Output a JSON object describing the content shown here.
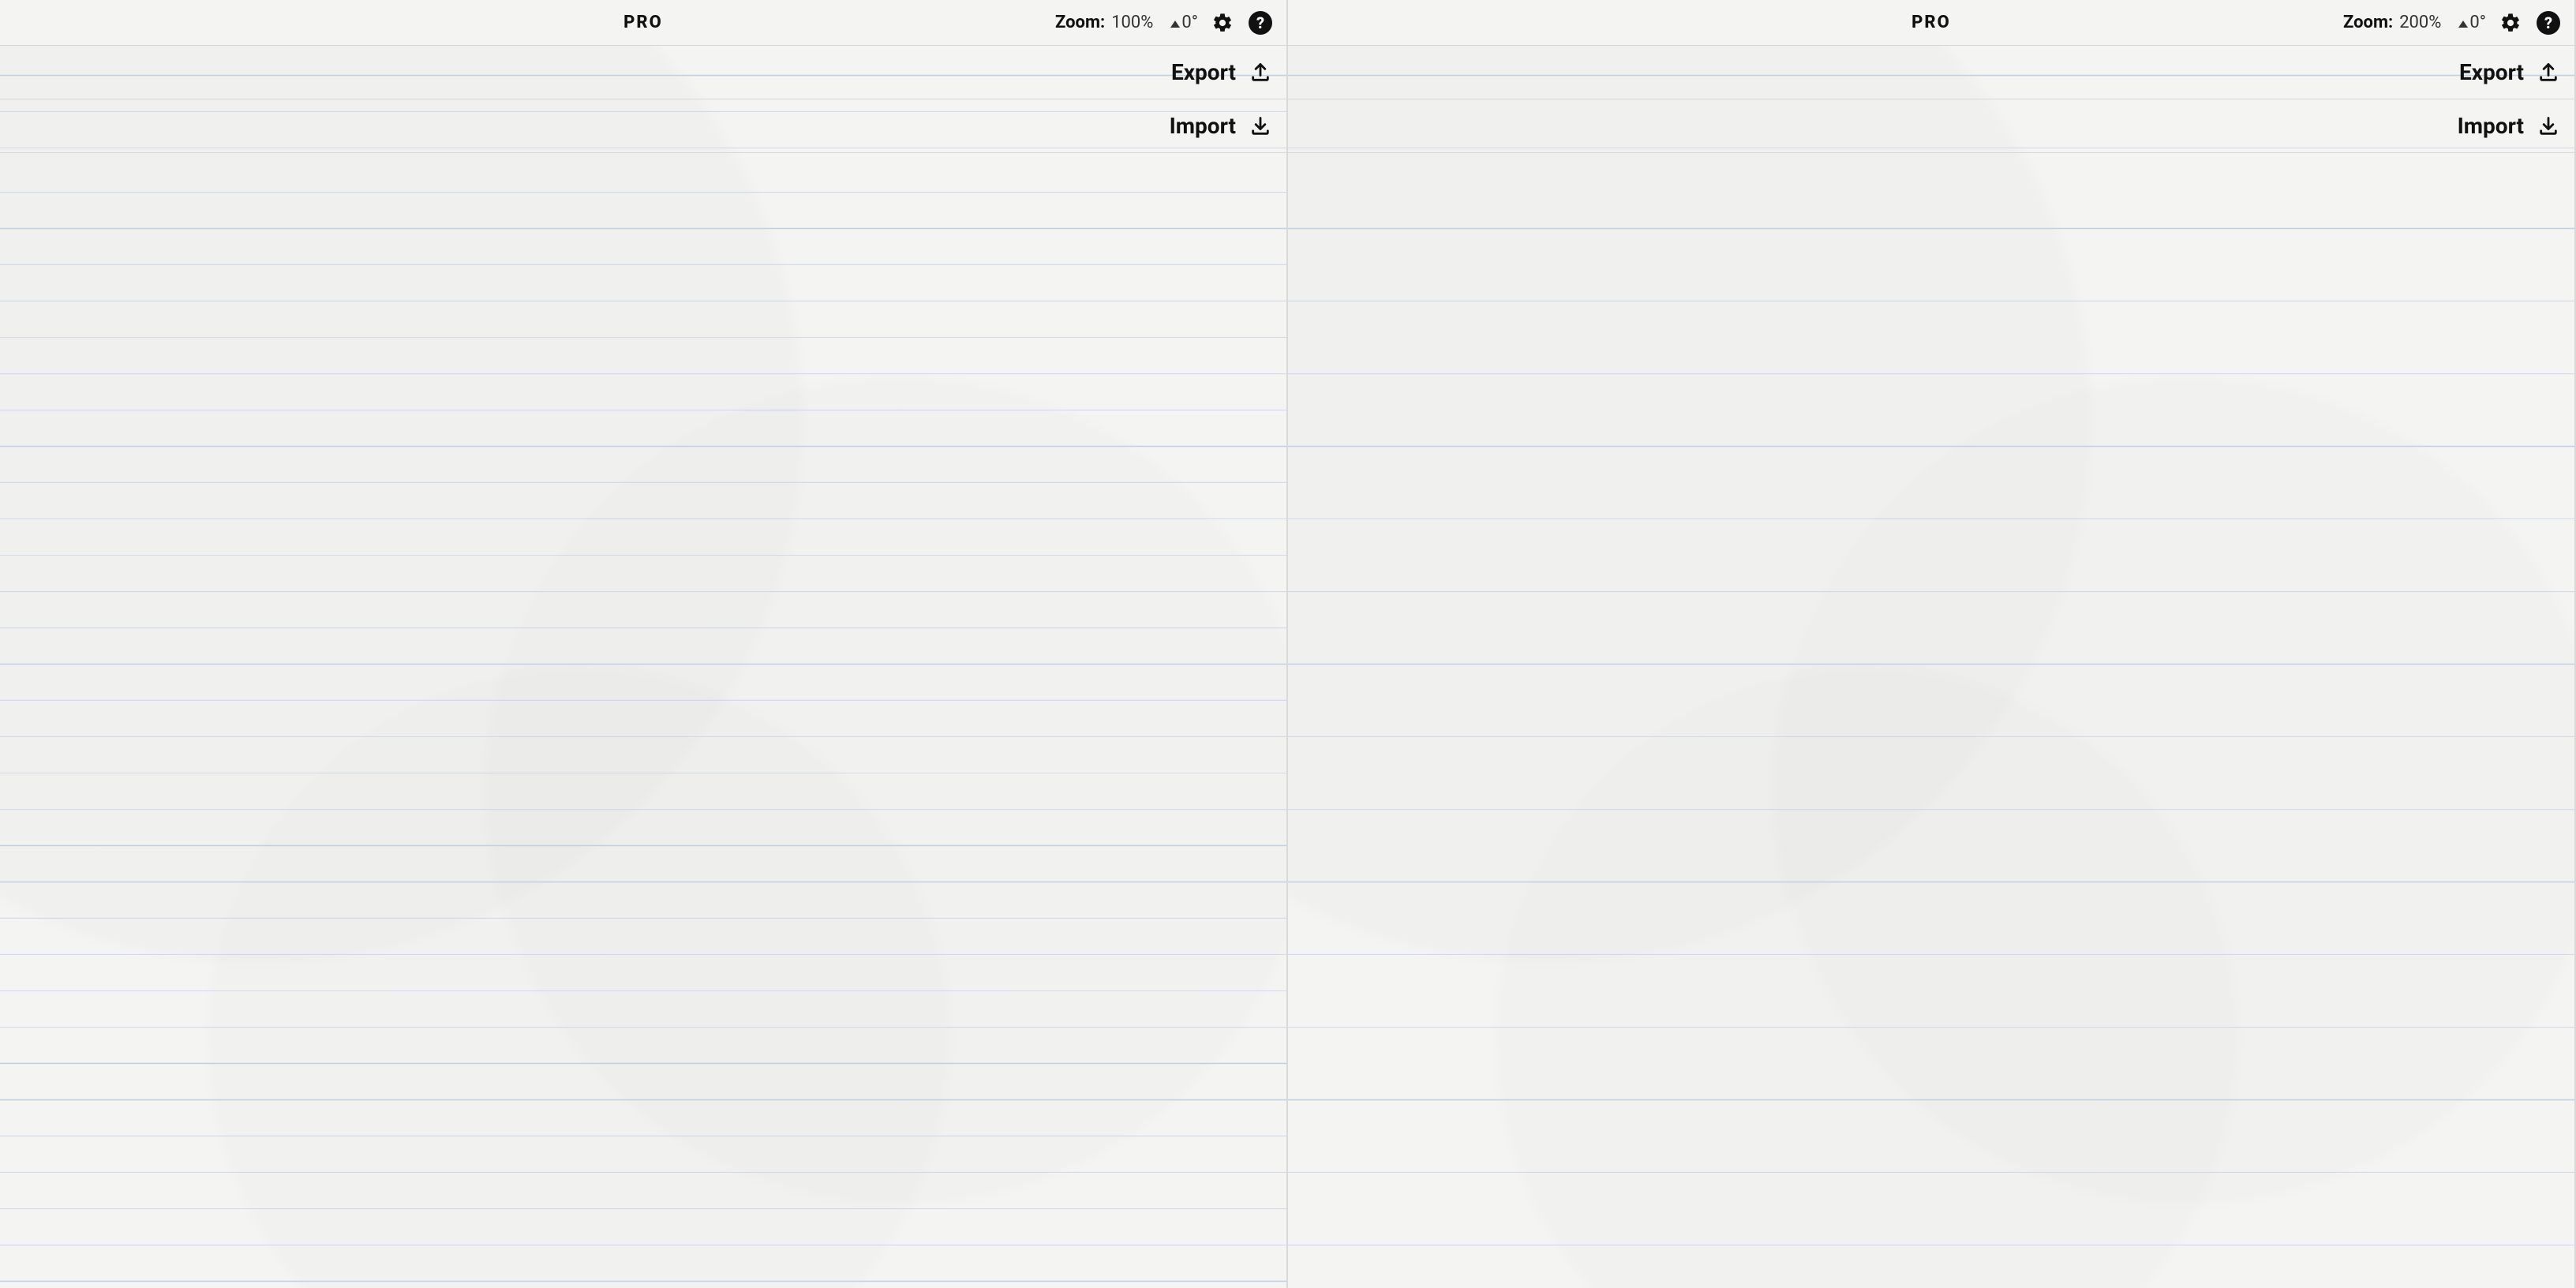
{
  "panes": [
    {
      "badge": "PRO",
      "zoom_label": "Zoom:",
      "zoom_value": "100%",
      "rotation": "0°",
      "export_label": "Export",
      "import_label": "Import"
    },
    {
      "badge": "PRO",
      "zoom_label": "Zoom:",
      "zoom_value": "200%",
      "rotation": "0°",
      "export_label": "Export",
      "import_label": "Import"
    }
  ]
}
